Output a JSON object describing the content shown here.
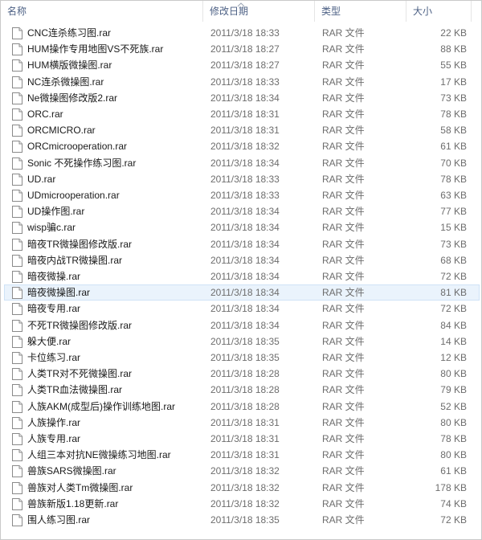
{
  "columns": {
    "name": "名称",
    "date": "修改日期",
    "type": "类型",
    "size": "大小"
  },
  "files": [
    {
      "name": "CNC连杀练习图.rar",
      "date": "2011/3/18 18:33",
      "type": "RAR 文件",
      "size": "22 KB"
    },
    {
      "name": "HUM操作专用地图VS不死族.rar",
      "date": "2011/3/18 18:27",
      "type": "RAR 文件",
      "size": "88 KB"
    },
    {
      "name": "HUM横版微操图.rar",
      "date": "2011/3/18 18:27",
      "type": "RAR 文件",
      "size": "55 KB"
    },
    {
      "name": "NC连杀微操图.rar",
      "date": "2011/3/18 18:33",
      "type": "RAR 文件",
      "size": "17 KB"
    },
    {
      "name": "Ne微操图修改版2.rar",
      "date": "2011/3/18 18:34",
      "type": "RAR 文件",
      "size": "73 KB"
    },
    {
      "name": "ORC.rar",
      "date": "2011/3/18 18:31",
      "type": "RAR 文件",
      "size": "78 KB"
    },
    {
      "name": "ORCMICRO.rar",
      "date": "2011/3/18 18:31",
      "type": "RAR 文件",
      "size": "58 KB"
    },
    {
      "name": "ORCmicrooperation.rar",
      "date": "2011/3/18 18:32",
      "type": "RAR 文件",
      "size": "61 KB"
    },
    {
      "name": "Sonic 不死操作练习图.rar",
      "date": "2011/3/18 18:34",
      "type": "RAR 文件",
      "size": "70 KB"
    },
    {
      "name": "UD.rar",
      "date": "2011/3/18 18:33",
      "type": "RAR 文件",
      "size": "78 KB"
    },
    {
      "name": "UDmicrooperation.rar",
      "date": "2011/3/18 18:33",
      "type": "RAR 文件",
      "size": "63 KB"
    },
    {
      "name": "UD操作图.rar",
      "date": "2011/3/18 18:34",
      "type": "RAR 文件",
      "size": "77 KB"
    },
    {
      "name": "wisp骗c.rar",
      "date": "2011/3/18 18:34",
      "type": "RAR 文件",
      "size": "15 KB"
    },
    {
      "name": "暗夜TR微操图修改版.rar",
      "date": "2011/3/18 18:34",
      "type": "RAR 文件",
      "size": "73 KB"
    },
    {
      "name": "暗夜内战TR微操图.rar",
      "date": "2011/3/18 18:34",
      "type": "RAR 文件",
      "size": "68 KB"
    },
    {
      "name": "暗夜微操.rar",
      "date": "2011/3/18 18:34",
      "type": "RAR 文件",
      "size": "72 KB"
    },
    {
      "name": "暗夜微操图.rar",
      "date": "2011/3/18 18:34",
      "type": "RAR 文件",
      "size": "81 KB",
      "selected": true
    },
    {
      "name": "暗夜专用.rar",
      "date": "2011/3/18 18:34",
      "type": "RAR 文件",
      "size": "72 KB"
    },
    {
      "name": "不死TR微操图修改版.rar",
      "date": "2011/3/18 18:34",
      "type": "RAR 文件",
      "size": "84 KB"
    },
    {
      "name": "躲大便.rar",
      "date": "2011/3/18 18:35",
      "type": "RAR 文件",
      "size": "14 KB"
    },
    {
      "name": "卡位练习.rar",
      "date": "2011/3/18 18:35",
      "type": "RAR 文件",
      "size": "12 KB"
    },
    {
      "name": "人类TR对不死微操图.rar",
      "date": "2011/3/18 18:28",
      "type": "RAR 文件",
      "size": "80 KB"
    },
    {
      "name": "人类TR血法微操图.rar",
      "date": "2011/3/18 18:28",
      "type": "RAR 文件",
      "size": "79 KB"
    },
    {
      "name": "人族AKM(成型后)操作训练地图.rar",
      "date": "2011/3/18 18:28",
      "type": "RAR 文件",
      "size": "52 KB"
    },
    {
      "name": "人族操作.rar",
      "date": "2011/3/18 18:31",
      "type": "RAR 文件",
      "size": "80 KB"
    },
    {
      "name": "人族专用.rar",
      "date": "2011/3/18 18:31",
      "type": "RAR 文件",
      "size": "78 KB"
    },
    {
      "name": "人组三本对抗NE微操练习地图.rar",
      "date": "2011/3/18 18:31",
      "type": "RAR 文件",
      "size": "80 KB"
    },
    {
      "name": "兽族SARS微操图.rar",
      "date": "2011/3/18 18:32",
      "type": "RAR 文件",
      "size": "61 KB"
    },
    {
      "name": "兽族对人类Tm微操图.rar",
      "date": "2011/3/18 18:32",
      "type": "RAR 文件",
      "size": "178 KB"
    },
    {
      "name": "兽族新版1.18更新.rar",
      "date": "2011/3/18 18:32",
      "type": "RAR 文件",
      "size": "74 KB"
    },
    {
      "name": "围人练习图.rar",
      "date": "2011/3/18 18:35",
      "type": "RAR 文件",
      "size": "72 KB"
    }
  ]
}
